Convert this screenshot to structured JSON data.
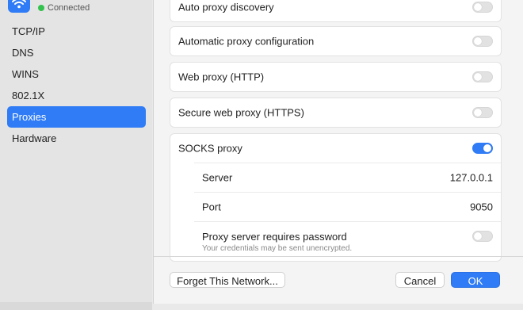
{
  "sidebar": {
    "network_status": "Connected",
    "items": [
      {
        "label": "TCP/IP"
      },
      {
        "label": "DNS"
      },
      {
        "label": "WINS"
      },
      {
        "label": "802.1X"
      },
      {
        "label": "Proxies",
        "selected": true
      },
      {
        "label": "Hardware"
      }
    ]
  },
  "proxies": {
    "auto_discovery": {
      "label": "Auto proxy discovery",
      "enabled": false
    },
    "auto_config": {
      "label": "Automatic proxy configuration",
      "enabled": false
    },
    "web_http": {
      "label": "Web proxy (HTTP)",
      "enabled": false
    },
    "secure_https": {
      "label": "Secure web proxy (HTTPS)",
      "enabled": false
    },
    "socks": {
      "label": "SOCKS proxy",
      "enabled": true,
      "server_label": "Server",
      "server_value": "127.0.0.1",
      "port_label": "Port",
      "port_value": "9050",
      "password_label": "Proxy server requires password",
      "password_caption": "Your credentials may be sent unencrypted.",
      "password_required": false
    }
  },
  "footer": {
    "forget_label": "Forget This Network...",
    "cancel_label": "Cancel",
    "ok_label": "OK"
  },
  "colors": {
    "accent": "#2f7cf6",
    "connected": "#33c24d"
  }
}
